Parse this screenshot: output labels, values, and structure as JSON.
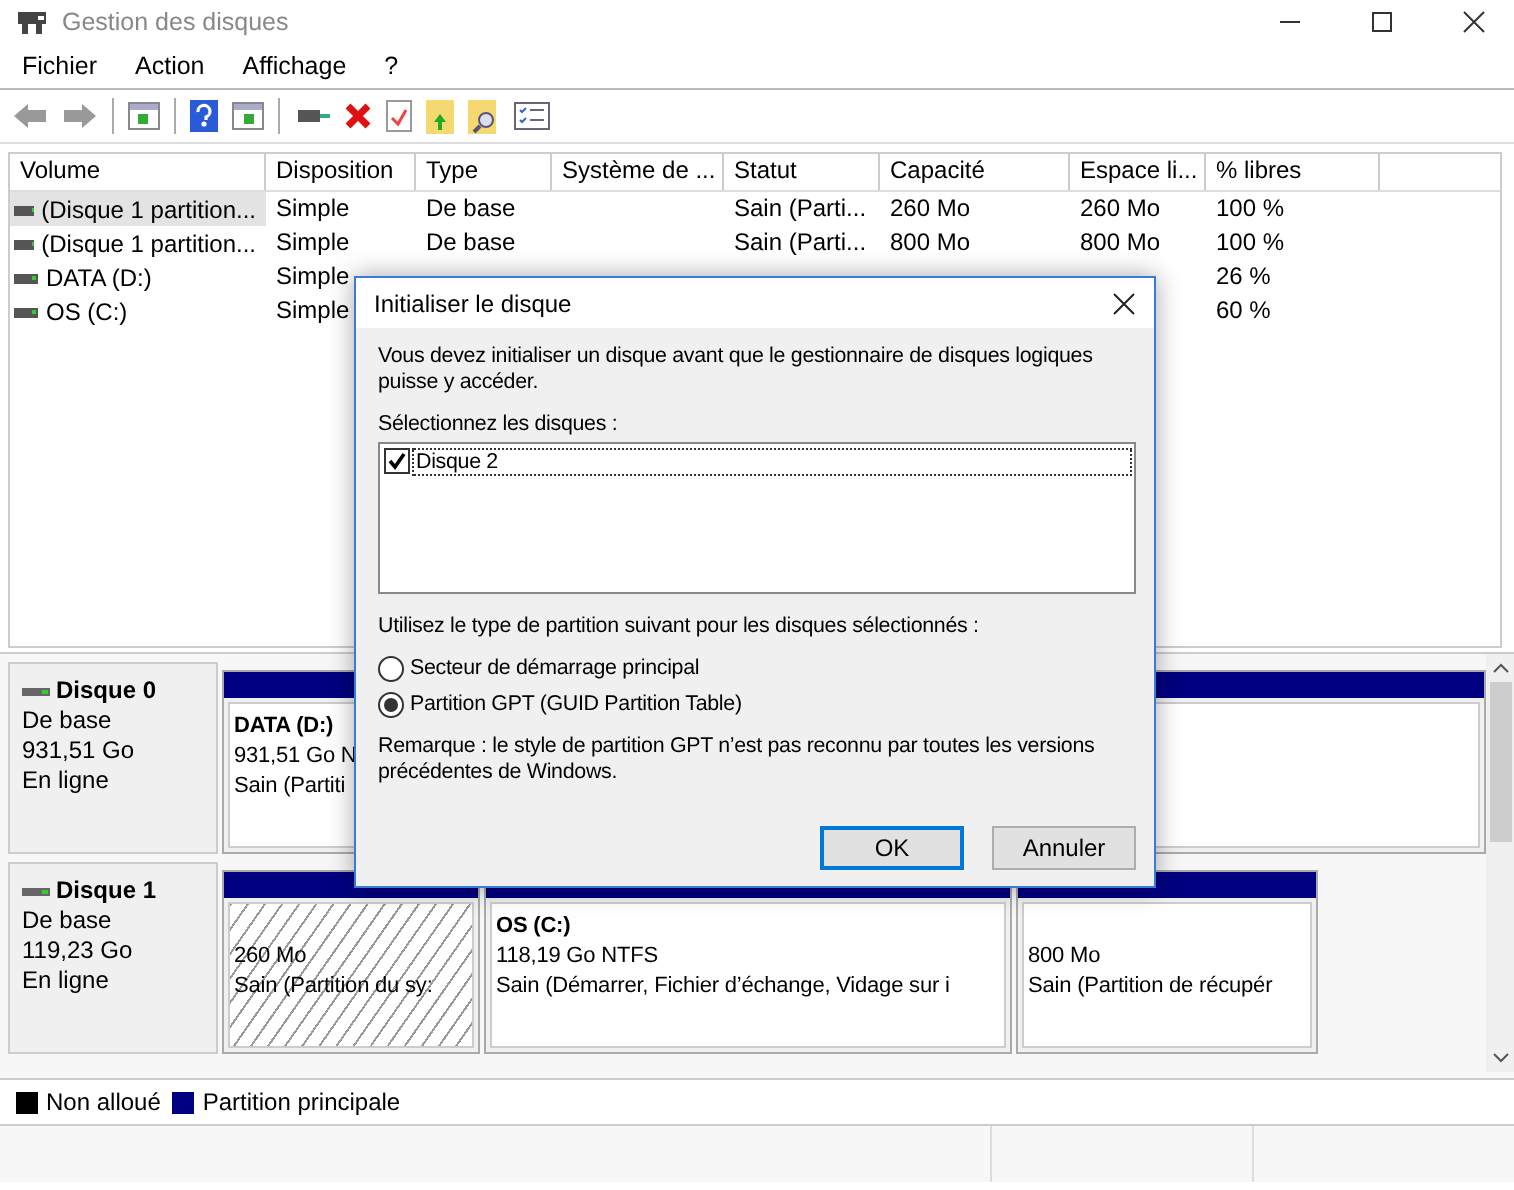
{
  "window": {
    "title": "Gestion des disques"
  },
  "menu": [
    "Fichier",
    "Action",
    "Affichage",
    "?"
  ],
  "table": {
    "columns": [
      "Volume",
      "Disposition",
      "Type",
      "Système de ...",
      "Statut",
      "Capacité",
      "Espace li...",
      "% libres"
    ],
    "rows": [
      {
        "selected": true,
        "volume": "(Disque 1 partition...",
        "disposition": "Simple",
        "type": "De base",
        "status": "Sain (Parti...",
        "capacity": "260 Mo",
        "free_space": "260 Mo",
        "percent_free": "100 %"
      },
      {
        "selected": false,
        "volume": "(Disque 1 partition...",
        "disposition": "Simple",
        "type": "De base",
        "status": "Sain (Parti...",
        "capacity": "800 Mo",
        "free_space": "800 Mo",
        "percent_free": "100 %"
      },
      {
        "selected": false,
        "volume": "DATA (D:)",
        "disposition": "Simple",
        "percent_free": "26 %"
      },
      {
        "selected": false,
        "volume": "OS (C:)",
        "disposition": "Simple",
        "percent_free": "60 %"
      }
    ]
  },
  "disks": [
    {
      "name": "Disque 0",
      "type": "De base",
      "size": "931,51 Go",
      "status": "En ligne",
      "partitions": [
        {
          "selected": false,
          "name": "DATA  (D:)",
          "size": "931,51 Go N",
          "status": "Sain (Partiti"
        }
      ]
    },
    {
      "name": "Disque 1",
      "type": "De base",
      "size": "119,23 Go",
      "status": "En ligne",
      "partitions": [
        {
          "selected": true,
          "size": "260 Mo",
          "status": "Sain (Partition du sy:"
        },
        {
          "selected": false,
          "name": "OS  (C:)",
          "size": "118,19 Go NTFS",
          "status": "Sain (Démarrer, Fichier d’échange, Vidage sur i"
        },
        {
          "selected": false,
          "size": "800 Mo",
          "status": "Sain (Partition de récupér"
        }
      ]
    }
  ],
  "legend": [
    {
      "label": "Non alloué",
      "color": "#000000"
    },
    {
      "label": "Partition principale",
      "color": "#000080"
    }
  ],
  "dialog": {
    "title": "Initialiser le disque",
    "message": "Vous devez initialiser un disque avant que le gestionnaire de disques logiques puisse y accéder.",
    "list_label": "Sélectionnez les disques :",
    "disks": [
      {
        "label": "Disque 2",
        "checked": true,
        "selected": true
      }
    ],
    "partition_label": "Utilisez le type de partition suivant pour les disques sélectionnés :",
    "options": [
      {
        "label": "Secteur de démarrage principal",
        "selected": false
      },
      {
        "label": "Partition GPT (GUID Partition Table)",
        "selected": true
      }
    ],
    "note": "Remarque : le style de partition GPT n’est pas reconnu par toutes les versions précédentes de Windows.",
    "buttons": [
      {
        "label": "OK",
        "default": true
      },
      {
        "label": "Annuler",
        "default": false
      }
    ]
  }
}
